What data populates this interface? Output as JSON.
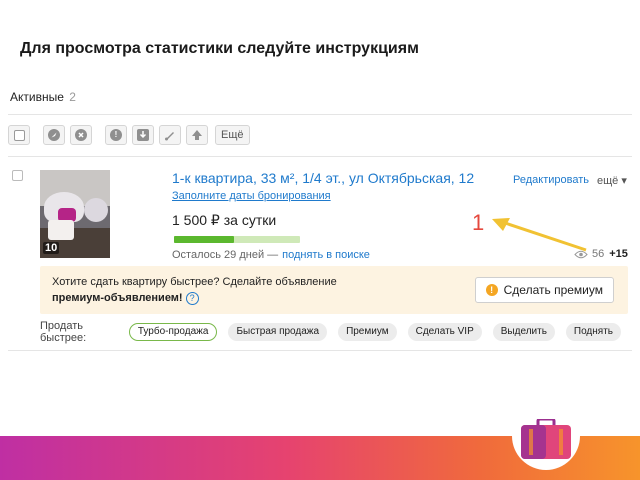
{
  "slide": {
    "title": "Для просмотра статистики следуйте инструкциям"
  },
  "tabs": {
    "label": "Активные",
    "count": "2"
  },
  "toolbar": {
    "icons": [
      "checkbox-icon",
      "activate-icon",
      "close-icon",
      "info-icon",
      "download-icon",
      "brush-icon",
      "up-arrow-icon"
    ],
    "info_glyph": "!",
    "more_label": "Ещё"
  },
  "listing": {
    "photo_count": "10",
    "title": "1-к квартира, 33 м², 1/4 эт., ул Октябрьская, 12",
    "booking_link": "Заполните даты бронирования",
    "price": "1 500 ₽ за сутки",
    "progress_fraction": 0.48,
    "remaining_text": "Осталось 29 дней —",
    "raise_link": "поднять в поиске",
    "edit_label": "Редактировать",
    "more_label": "ещё ▾",
    "views_count": "56",
    "views_delta": "+15"
  },
  "annotation": {
    "number": "1",
    "color": "#e5483d"
  },
  "promo": {
    "line1": "Хотите сдать квартиру быстрее? Сделайте объявление",
    "line2_bold": "премиум",
    "line2_rest": "-объявлением!",
    "help_glyph": "?",
    "button_label": "Сделать премиум",
    "button_icon_glyph": "!"
  },
  "sell_fast": {
    "label": "Продать быстрее:",
    "options": [
      "Турбо-продажа",
      "Быстрая продажа",
      "Премиум",
      "Сделать VIP",
      "Выделить",
      "Поднять"
    ],
    "active_index": 0
  },
  "colors": {
    "link": "#1f7acc",
    "progress_fill": "#5bb82e",
    "promo_bg": "#fdf3e1",
    "band_start": "#bf2fa3",
    "band_end": "#f7942b"
  }
}
